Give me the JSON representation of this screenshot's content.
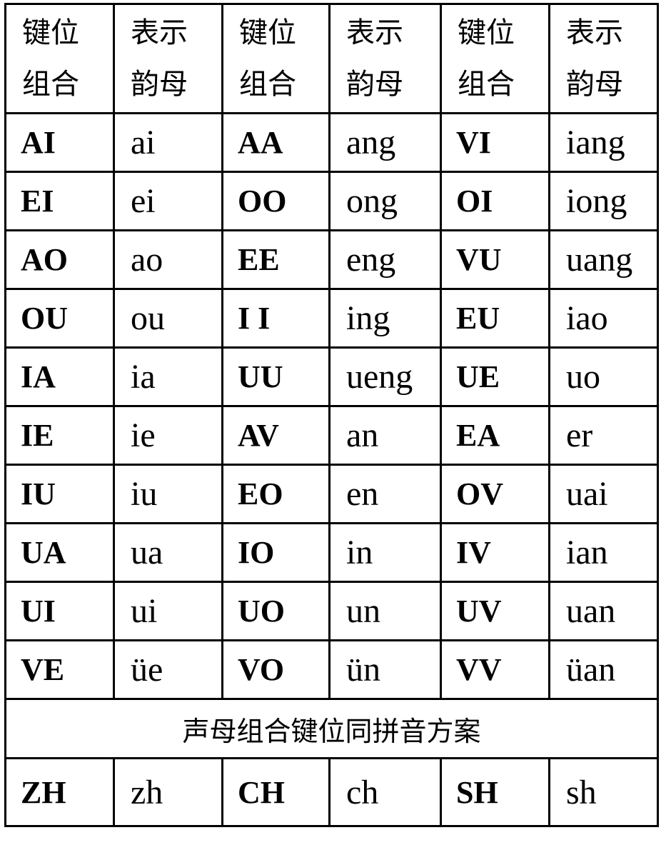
{
  "header": [
    {
      "line1": "键位",
      "line2": "组合"
    },
    {
      "line1": "表示",
      "line2": "韵母"
    },
    {
      "line1": "键位",
      "line2": "组合"
    },
    {
      "line1": "表示",
      "line2": "韵母"
    },
    {
      "line1": "键位",
      "line2": "组合"
    },
    {
      "line1": "表示",
      "line2": "韵母"
    }
  ],
  "rows": [
    [
      "AI",
      "ai",
      "AA",
      "ang",
      "VI",
      "iang"
    ],
    [
      "EI",
      "ei",
      "OO",
      "ong",
      "OI",
      "iong"
    ],
    [
      "AO",
      "ao",
      "EE",
      "eng",
      "VU",
      "uang"
    ],
    [
      "OU",
      "ou",
      "I I",
      "ing",
      "EU",
      "iao"
    ],
    [
      "IA",
      "ia",
      "UU",
      "ueng",
      "UE",
      "uo"
    ],
    [
      "IE",
      "ie",
      "AV",
      "an",
      "EA",
      "er"
    ],
    [
      "IU",
      "iu",
      "EO",
      "en",
      "OV",
      "uai"
    ],
    [
      "UA",
      "ua",
      "IO",
      "in",
      "IV",
      "ian"
    ],
    [
      "UI",
      "ui",
      "UO",
      "un",
      "UV",
      "uan"
    ],
    [
      "VE",
      "üe",
      "VO",
      "ün",
      "VV",
      "üan"
    ]
  ],
  "section_title": "声母组合键位同拼音方案",
  "initials_row": [
    "ZH",
    "zh",
    "CH",
    "ch",
    "SH",
    "sh"
  ]
}
